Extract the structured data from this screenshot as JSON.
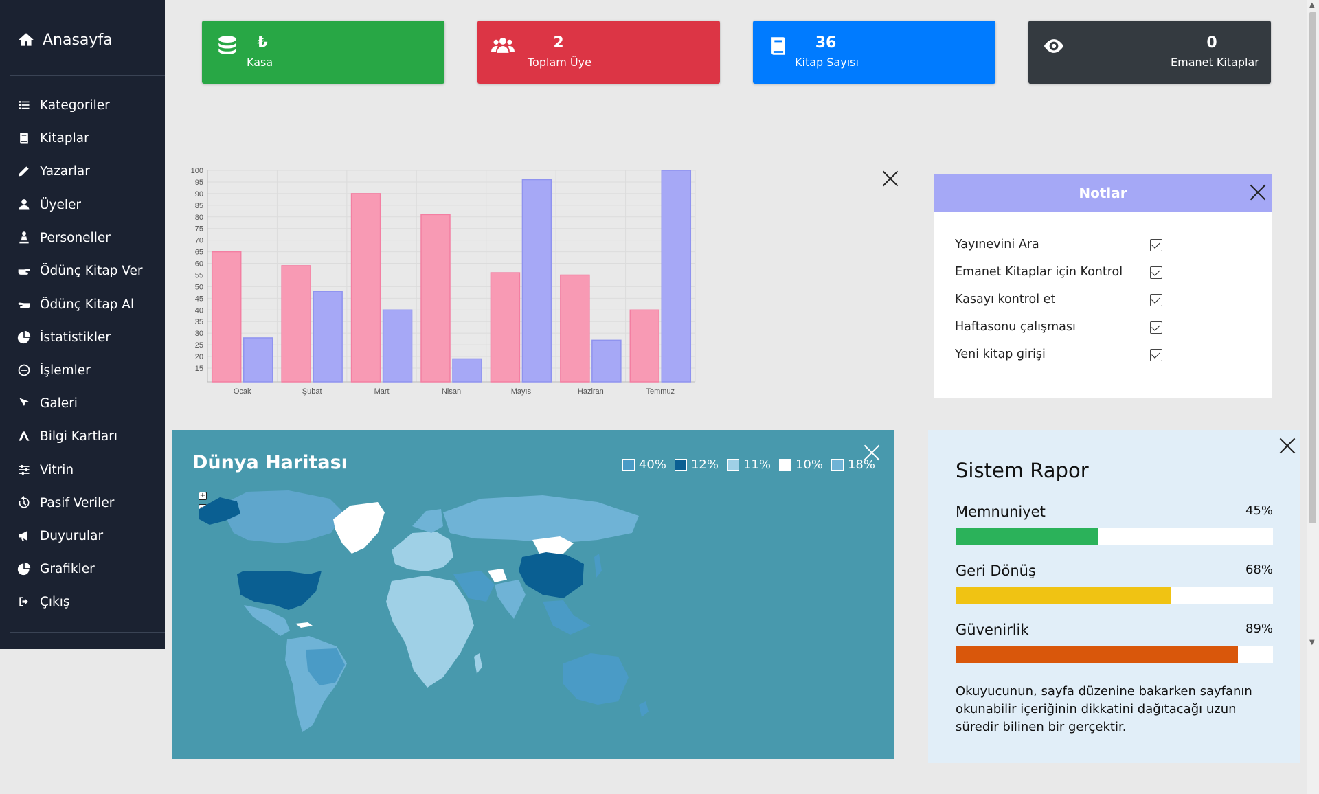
{
  "sidebar": {
    "home_label": "Anasayfa",
    "items": [
      {
        "label": "Kategoriler",
        "icon": "list-icon"
      },
      {
        "label": "Kitaplar",
        "icon": "book-icon"
      },
      {
        "label": "Yazarlar",
        "icon": "pencil-icon"
      },
      {
        "label": "Üyeler",
        "icon": "user-icon"
      },
      {
        "label": "Personeller",
        "icon": "staff-icon"
      },
      {
        "label": "Ödünç Kitap Ver",
        "icon": "hand-right-icon"
      },
      {
        "label": "Ödünç Kitap Al",
        "icon": "hand-left-icon"
      },
      {
        "label": "İstatistikler",
        "icon": "pie-chart-icon"
      },
      {
        "label": "İşlemler",
        "icon": "minus-circle-icon"
      },
      {
        "label": "Galeri",
        "icon": "image-icon"
      },
      {
        "label": "Bilgi Kartları",
        "icon": "cards-icon"
      },
      {
        "label": "Vitrin",
        "icon": "sliders-icon"
      },
      {
        "label": "Pasif Veriler",
        "icon": "history-icon"
      },
      {
        "label": "Duyurular",
        "icon": "megaphone-icon"
      },
      {
        "label": "Grafikler",
        "icon": "pie-chart-icon"
      },
      {
        "label": "Çıkış",
        "icon": "logout-icon"
      }
    ]
  },
  "cards": [
    {
      "value": "₺",
      "label": "Kasa",
      "color": "#28a745",
      "icon": "coins-icon"
    },
    {
      "value": "2",
      "label": "Toplam Üye",
      "color": "#dc3545",
      "icon": "users-icon"
    },
    {
      "value": "36",
      "label": "Kitap Sayısı",
      "color": "#007bff",
      "icon": "book-icon"
    },
    {
      "value": "0",
      "label": "Emanet Kitaplar",
      "color": "#343a40",
      "icon": "eye-icon"
    }
  ],
  "chart_data": {
    "type": "bar",
    "categories": [
      "Ocak",
      "Şubat",
      "Mart",
      "Nisan",
      "Mayıs",
      "Haziran",
      "Temmuz"
    ],
    "series": [
      {
        "values": [
          65,
          59,
          90,
          81,
          56,
          55,
          40
        ],
        "color": "#f89ab4"
      },
      {
        "values": [
          28,
          48,
          40,
          19,
          96,
          27,
          100
        ],
        "color": "#a6a8f6"
      }
    ],
    "ylim": [
      15,
      100
    ],
    "yticks": [
      15,
      20,
      25,
      30,
      35,
      40,
      45,
      50,
      55,
      60,
      65,
      70,
      75,
      80,
      85,
      90,
      95,
      100
    ],
    "grid": true
  },
  "notes": {
    "title": "Notlar",
    "items": [
      {
        "label": "Yayınevini Ara",
        "checked": true
      },
      {
        "label": "Emanet Kitaplar için Kontrol",
        "checked": true
      },
      {
        "label": "Kasayı kontrol et",
        "checked": true
      },
      {
        "label": "Haftasonu çalışması",
        "checked": true
      },
      {
        "label": "Yeni kitap girişi",
        "checked": true
      }
    ]
  },
  "map": {
    "title": "Dünya Haritası",
    "legend": [
      {
        "label": "40%",
        "color": "#4a9bc6"
      },
      {
        "label": "12%",
        "color": "#0a5f92"
      },
      {
        "label": "11%",
        "color": "#9fd0e6"
      },
      {
        "label": "10%",
        "color": "#ffffff"
      },
      {
        "label": "18%",
        "color": "#6fb3d6"
      }
    ],
    "zoom_in": "+",
    "zoom_out": "−"
  },
  "report": {
    "title": "Sistem Rapor",
    "items": [
      {
        "label": "Memnuniyet",
        "pct_text": "45%",
        "value": 0.45,
        "color": "#2bb25a"
      },
      {
        "label": "Geri Dönüş",
        "pct_text": "68%",
        "value": 0.68,
        "color": "#f0c313"
      },
      {
        "label": "Güvenirlik",
        "pct_text": "89%",
        "value": 0.89,
        "color": "#d9570b"
      }
    ],
    "text": "Okuyucunun, sayfa düzenine bakarken sayfanın okunabilir içeriğinin dikkatini dağıtacağı uzun süredir bilinen bir gerçektir."
  }
}
